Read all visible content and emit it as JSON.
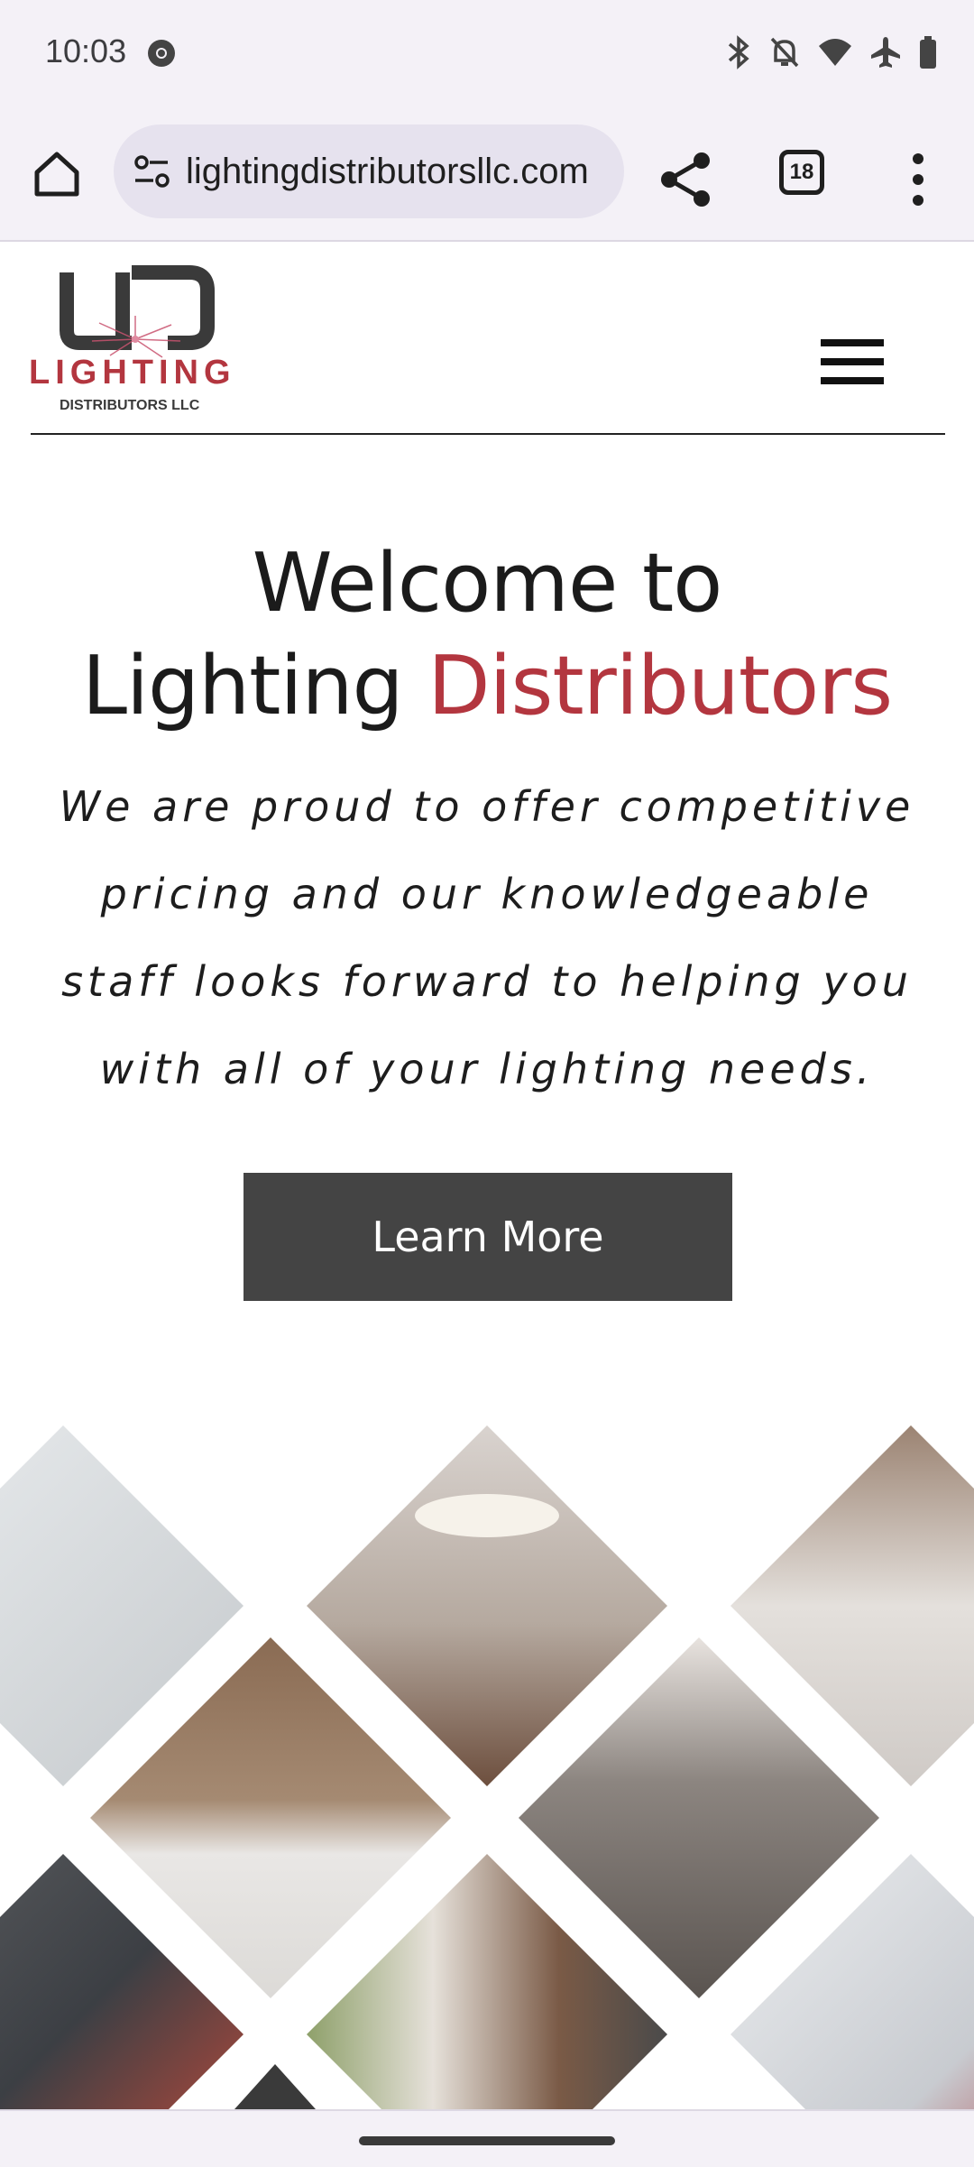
{
  "status_bar": {
    "time": "10:03",
    "icons": [
      "chrome-icon",
      "bluetooth-icon",
      "bell-off-icon",
      "wifi-icon",
      "airplane-icon",
      "battery-icon"
    ]
  },
  "browser": {
    "url": "lightingdistributorsllc.com",
    "tab_count": "18"
  },
  "site": {
    "logo": {
      "mark": "LD",
      "brand": "LIGHTING",
      "sub": "DISTRIBUTORS LLC"
    },
    "hero": {
      "title_line1": "Welcome to",
      "title_line2_plain": "Lighting",
      "title_line2_accent": "Distributors",
      "subtitle": "We are proud to offer competitive pricing and our knowledgeable staff looks forward to helping you with all of your lighting needs.",
      "cta_label": "Learn More"
    },
    "gallery": {
      "tiles": [
        "kitchen-interior",
        "ceiling-light-room",
        "pendant-lights-counter",
        "wood-kitchen-track-lights",
        "lobby-lounge",
        "colorful-wall-lights",
        "fireplace-living-room",
        "modern-red-interior"
      ]
    }
  },
  "colors": {
    "accent": "#b3363f",
    "button": "#444444",
    "chrome_bg": "#f4f1f7",
    "url_bg": "#e6e2ee"
  }
}
